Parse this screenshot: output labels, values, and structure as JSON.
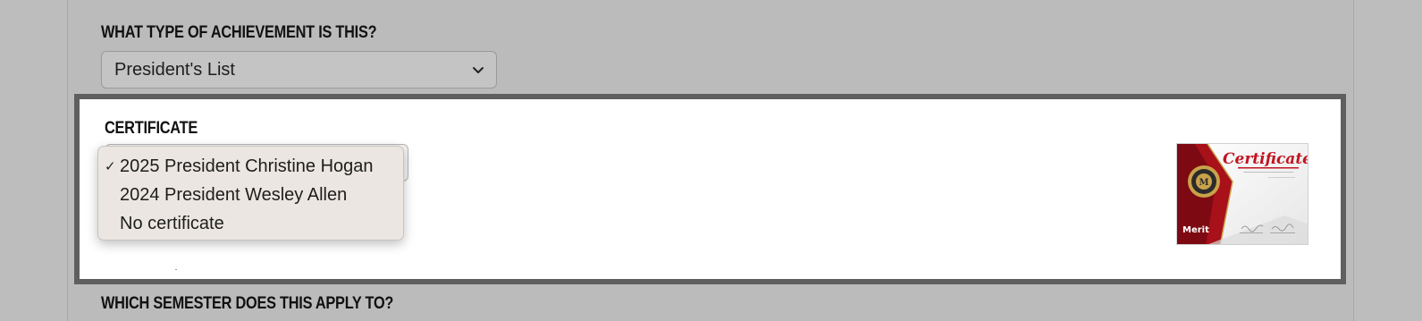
{
  "form": {
    "achievement_type": {
      "question": "WHAT TYPE OF ACHIEVEMENT IS THIS?",
      "selected": "President's List"
    },
    "certificate": {
      "label": "CERTIFICATE",
      "options": [
        {
          "label": "2025 President Christine Hogan",
          "selected": true,
          "check": "✓"
        },
        {
          "label": "2024 President Wesley Allen",
          "selected": false,
          "check": ""
        },
        {
          "label": "No certificate",
          "selected": false,
          "check": ""
        }
      ],
      "preview": {
        "title": "Certificate",
        "brand": "Merit",
        "seal_letter": "M"
      }
    },
    "semester": {
      "question": "WHICH SEMESTER DOES THIS APPLY TO?"
    }
  },
  "colors": {
    "page_bg": "#bbbbbb",
    "panel_border": "#5f5f5f",
    "certificate_red": "#b1121b",
    "seal_gold": "#c9a24a"
  }
}
